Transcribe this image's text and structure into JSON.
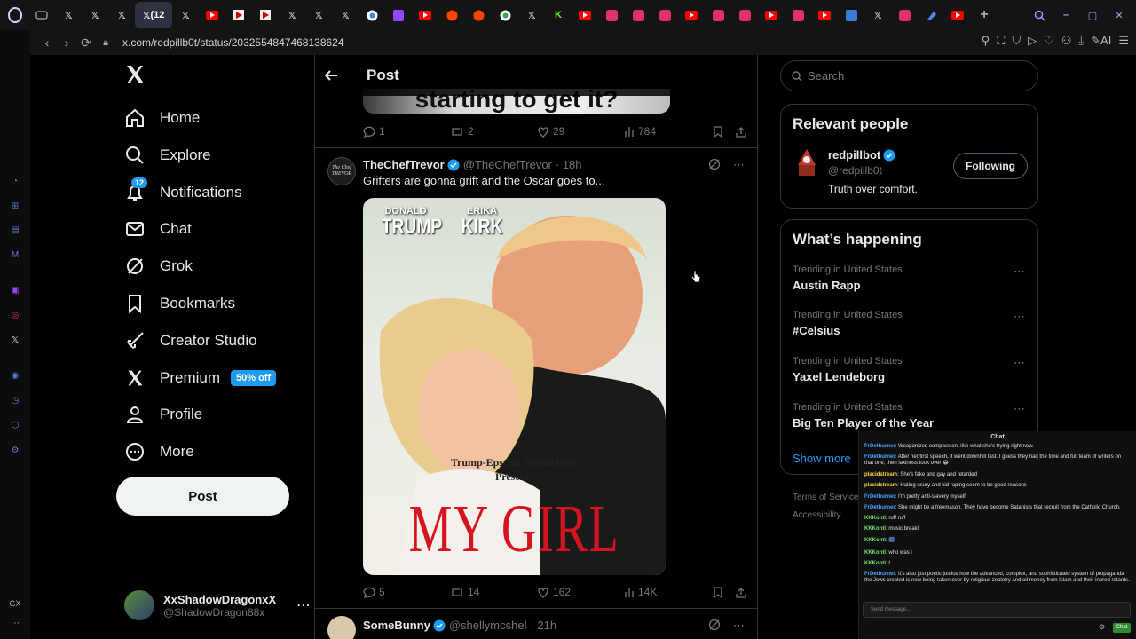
{
  "browser": {
    "active_tab_label": "(12",
    "url": "x.com/redpillb0t/status/2032554847468138624",
    "ai_label": "AI"
  },
  "nav": {
    "logo": "X",
    "items": [
      {
        "label": "Home",
        "icon": "home-icon"
      },
      {
        "label": "Explore",
        "icon": "search-icon"
      },
      {
        "label": "Notifications",
        "icon": "bell-icon",
        "badge": "12"
      },
      {
        "label": "Chat",
        "icon": "mail-icon"
      },
      {
        "label": "Grok",
        "icon": "grok-icon"
      },
      {
        "label": "Bookmarks",
        "icon": "bookmark-icon"
      },
      {
        "label": "Creator Studio",
        "icon": "rocket-icon"
      },
      {
        "label": "Premium",
        "icon": "x-logo-icon",
        "promo": "50% off"
      },
      {
        "label": "Profile",
        "icon": "person-icon"
      },
      {
        "label": "More",
        "icon": "more-circle-icon"
      }
    ],
    "post_button": "Post",
    "account": {
      "name": "XxShadowDragonxX",
      "handle": "@ShadowDragon88x"
    }
  },
  "main": {
    "title": "Post",
    "prev_tweet": {
      "image_text": "starting to get it?",
      "replies": "1",
      "reposts": "2",
      "likes": "29",
      "views": "784"
    },
    "tweet": {
      "name": "TheChefTrevor",
      "handle": "@TheChefTrevor",
      "time": "· 18h",
      "text": "Grifters are gonna grift and the Oscar goes to...",
      "avatar_text": "The Chef TREVOR",
      "poster": {
        "name1_first": "DONALD",
        "name1_last": "TRUMP",
        "name2_first": "ERIKA",
        "name2_last": "KIRK",
        "producer": "Trump-Epstein Productions",
        "presents": "Presents",
        "title": "MY GIRL"
      },
      "replies": "5",
      "reposts": "14",
      "likes": "162",
      "views": "14K"
    },
    "next_tweet": {
      "name": "SomeBunny",
      "handle": "@shellymcshel",
      "time": "· 21h"
    }
  },
  "right": {
    "search_placeholder": "Search",
    "relevant_title": "Relevant people",
    "person": {
      "name": "redpillbot",
      "handle": "@redpillb0t",
      "bio": "Truth over comfort.",
      "button": "Following"
    },
    "happening_title": "What’s happening",
    "trends": [
      {
        "context": "Trending in United States",
        "name": "Austin Rapp"
      },
      {
        "context": "Trending in United States",
        "name": "#Celsius"
      },
      {
        "context": "Trending in United States",
        "name": "Yaxel Lendeborg"
      },
      {
        "context": "Trending in United States",
        "name": "Big Ten Player of the Year"
      }
    ],
    "show_more": "Show more",
    "footer": {
      "terms": "Terms of Service",
      "accessibility": "Accessibility"
    }
  },
  "chat": {
    "title": "Chat",
    "messages": [
      {
        "user": "FrDetburner",
        "text": "Weaponized compassion, like what she's trying right now."
      },
      {
        "user": "FrDetburner",
        "text": "After her first speech, it went downhill fast. I guess they had the time and full team of writers on that one, then laxiness took over 😂"
      },
      {
        "user": "placidstream",
        "text": "She's fake and gay and retarded"
      },
      {
        "user": "placidstream",
        "text": "Hating usury and kid raping seem to be good reasons"
      },
      {
        "user": "FrDetburner",
        "text": "I'm pretty anti-slavery myself"
      },
      {
        "user": "FrDetburner",
        "text": "She might be a freemason. They have become Satanists that recruit from the Catholic Church."
      },
      {
        "user": "KKKonti",
        "text": "ruff ruff"
      },
      {
        "user": "KKKonti",
        "text": "music break!"
      },
      {
        "user": "KKKonti",
        "text": "🎆"
      },
      {
        "user": "KKKonti",
        "text": "who was i"
      },
      {
        "user": "KKKonti",
        "text": "t"
      },
      {
        "user": "FrDetburner",
        "text": "It's also just poetic justice how the advanced, complex, and sophisticated system of propaganda the Jews created is now being taken over by religious zealotry and oil money from Islam and their inbred retards."
      }
    ],
    "input_placeholder": "Send message...",
    "send_label": "Chat"
  },
  "colors": {
    "accent": "#1d9bf0",
    "bg": "#000000",
    "border": "#2f3336",
    "muted": "#71767b"
  }
}
